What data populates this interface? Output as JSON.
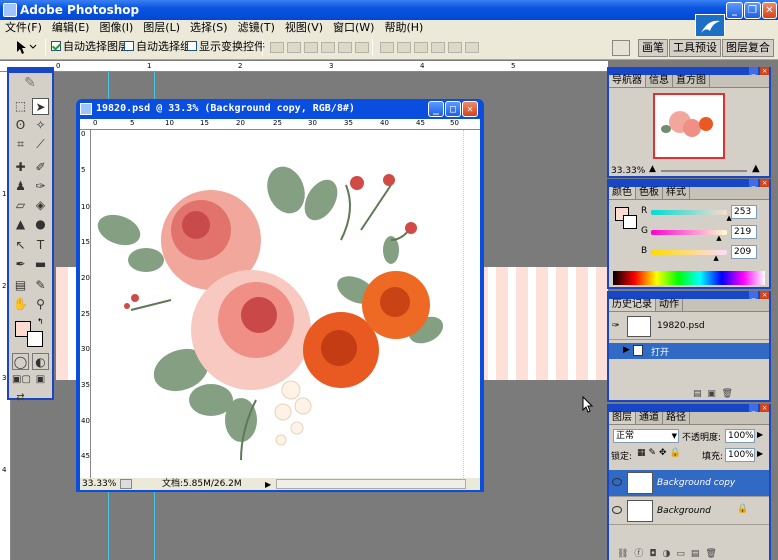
{
  "window": {
    "title": "Adobe Photoshop"
  },
  "menu": [
    "文件(F)",
    "编辑(E)",
    "图像(I)",
    "图层(L)",
    "选择(S)",
    "滤镜(T)",
    "视图(V)",
    "窗口(W)",
    "帮助(H)"
  ],
  "options": {
    "auto_select_layer": "自动选择图层",
    "auto_select_group": "自动选择组",
    "show_transform": "显示变换控件",
    "auto_select_layer_checked": true,
    "auto_select_group_checked": false,
    "show_transform_checked": false
  },
  "palette_well": [
    "画笔",
    "工具预设",
    "图层复合"
  ],
  "ruler_top": [
    "0",
    "1",
    "2",
    "3",
    "4",
    "5",
    "6",
    "7",
    "8",
    "9",
    "10",
    "11"
  ],
  "ruler_left": [
    "1",
    "2",
    "3",
    "4",
    "5",
    "6",
    "7",
    "8",
    "9"
  ],
  "document": {
    "title": "19820.psd @ 33.3% (Background copy, RGB/8#)",
    "ruler_top": [
      "0",
      "5",
      "10",
      "15",
      "20",
      "25",
      "30",
      "35",
      "40",
      "45",
      "50"
    ],
    "ruler_left": [
      "0",
      "5",
      "10",
      "15",
      "20",
      "25",
      "30",
      "35",
      "40",
      "45",
      "50"
    ],
    "zoom": "33.33%",
    "doc_size": "文档:5.85M/26.2M"
  },
  "navigator": {
    "tabs": [
      "导航器",
      "信息",
      "直方图"
    ],
    "zoom": "33.33%"
  },
  "color": {
    "tabs": [
      "颜色",
      "色板",
      "样式"
    ],
    "r_label": "R",
    "g_label": "G",
    "b_label": "B",
    "r": "253",
    "g": "219",
    "b": "209",
    "r_level": 0.992,
    "g_level": 0.859,
    "b_level": 0.82,
    "foreground": "#fddbd1"
  },
  "history": {
    "tabs": [
      "历史记录",
      "动作"
    ],
    "snapshot": "19820.psd",
    "step": "打开"
  },
  "layers": {
    "tabs": [
      "图层",
      "通道",
      "路径"
    ],
    "blend_mode": "正常",
    "opacity_label": "不透明度:",
    "opacity": "100%",
    "lock_label": "锁定:",
    "fill_label": "填充:",
    "fill": "100%",
    "items": [
      {
        "name": "Background copy",
        "selected": true
      },
      {
        "name": "Background",
        "selected": false
      }
    ]
  },
  "colors": {
    "titlebar": "#0a55e0",
    "selection": "#316ac5",
    "canvas_stripe": "#fde0d8"
  }
}
